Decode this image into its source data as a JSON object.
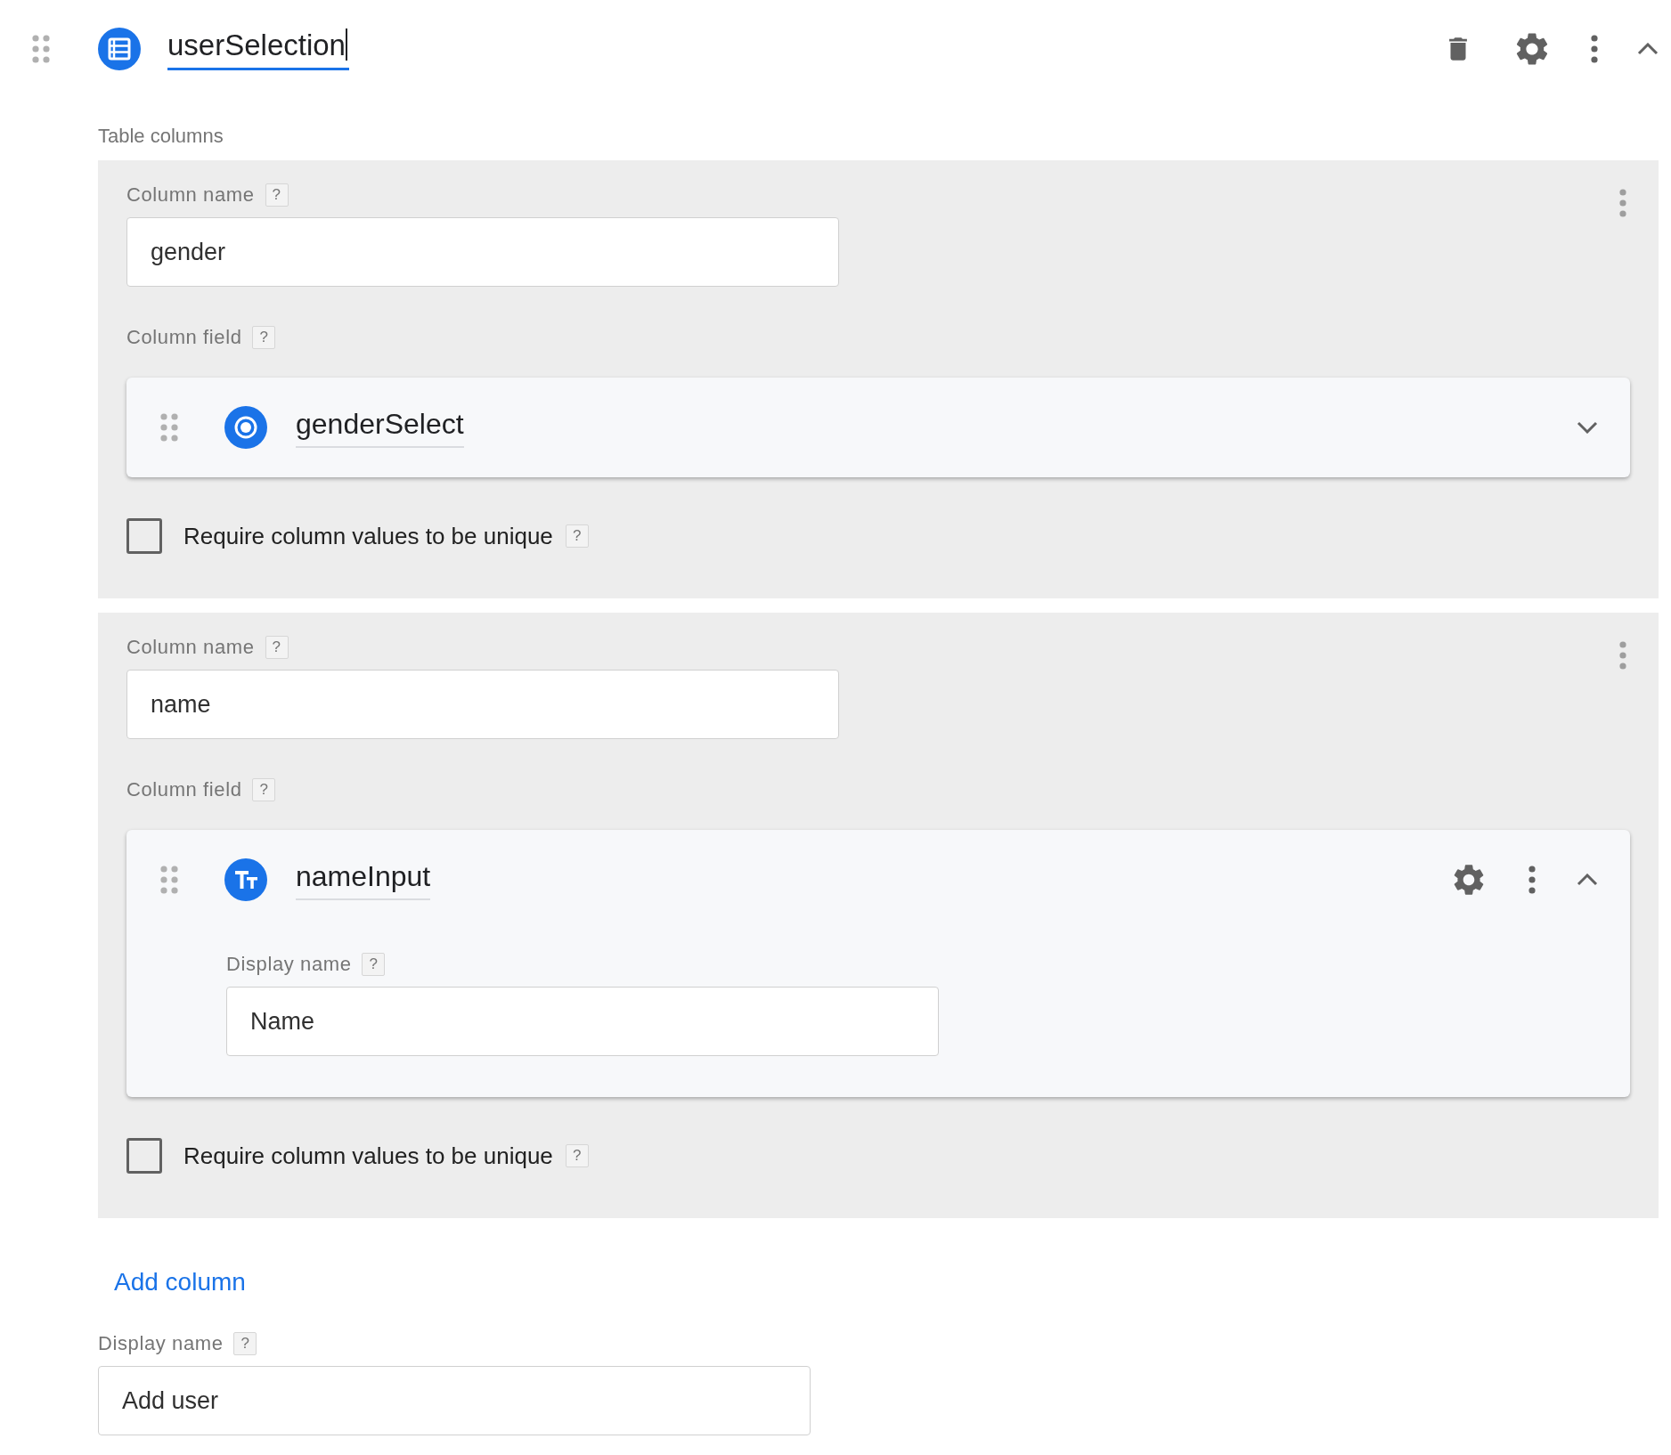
{
  "header": {
    "title": "userSelection",
    "kind": "table"
  },
  "section_label": "Table columns",
  "columns": [
    {
      "name_label": {
        "text": "Column name",
        "help": "?"
      },
      "name_value": "gender",
      "field_label": {
        "text": "Column field",
        "help": "?"
      },
      "field": {
        "name": "genderSelect",
        "kind": "select",
        "expanded": false
      },
      "unique": {
        "text": "Require column values to be unique",
        "help": "?",
        "checked": false
      }
    },
    {
      "name_label": {
        "text": "Column name",
        "help": "?"
      },
      "name_value": "name",
      "field_label": {
        "text": "Column field",
        "help": "?"
      },
      "field": {
        "name": "nameInput",
        "kind": "text",
        "expanded": true,
        "display_label": {
          "text": "Display name",
          "help": "?"
        },
        "display_value": "Name"
      },
      "unique": {
        "text": "Require column values to be unique",
        "help": "?",
        "checked": false
      }
    }
  ],
  "add_column": "Add column",
  "display_name": {
    "label": {
      "text": "Display name",
      "help": "?"
    },
    "value": "Add user"
  }
}
